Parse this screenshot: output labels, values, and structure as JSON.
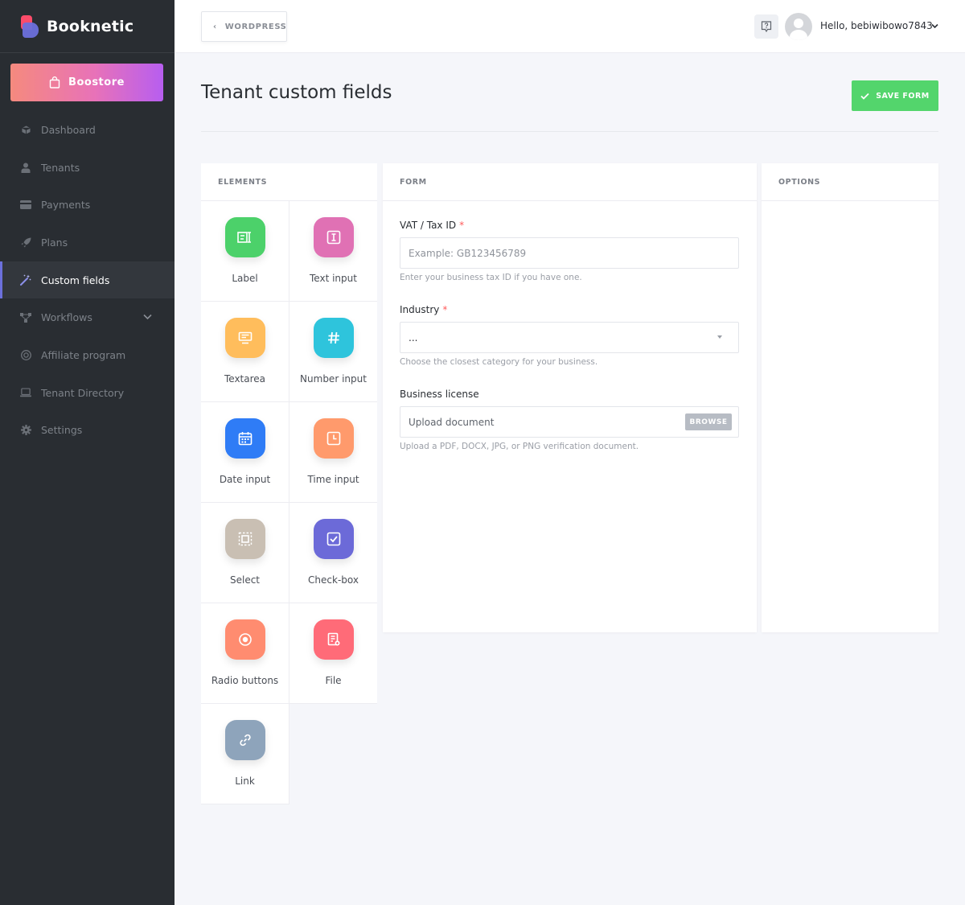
{
  "brand": {
    "name": "Booknetic"
  },
  "sidebar": {
    "boostore_label": "Boostore",
    "items": [
      {
        "label": "Dashboard",
        "icon": "cube-icon"
      },
      {
        "label": "Tenants",
        "icon": "user-tie-icon"
      },
      {
        "label": "Payments",
        "icon": "credit-card-icon"
      },
      {
        "label": "Plans",
        "icon": "rocket-icon"
      },
      {
        "label": "Custom fields",
        "icon": "magic-wand-icon",
        "active": true
      },
      {
        "label": "Workflows",
        "icon": "workflow-icon",
        "has_submenu": true
      },
      {
        "label": "Affiliate program",
        "icon": "target-icon"
      },
      {
        "label": "Tenant Directory",
        "icon": "laptop-icon"
      },
      {
        "label": "Settings",
        "icon": "gear-icon"
      }
    ]
  },
  "topbar": {
    "back_label": "WORDPRESS",
    "greeting": "Hello, bebiwibowo7843"
  },
  "page": {
    "title": "Tenant custom fields",
    "save_label": "SAVE FORM"
  },
  "panels": {
    "elements_title": "ELEMENTS",
    "form_title": "FORM",
    "options_title": "OPTIONS"
  },
  "elements": [
    {
      "label": "Label",
      "icon": "label-icon",
      "color": "#4cd16a"
    },
    {
      "label": "Text input",
      "icon": "text-cursor-icon",
      "color": "#e071b4"
    },
    {
      "label": "Textarea",
      "icon": "textarea-icon",
      "color": "#ffbd5c"
    },
    {
      "label": "Number input",
      "icon": "hash-icon",
      "color": "#2ec4dc"
    },
    {
      "label": "Date input",
      "icon": "calendar-icon",
      "color": "#2f7cf6"
    },
    {
      "label": "Time input",
      "icon": "clock-icon",
      "color": "#ff9a6c"
    },
    {
      "label": "Select",
      "icon": "select-icon",
      "color": "#c9bfb3"
    },
    {
      "label": "Check-box",
      "icon": "checkbox-icon",
      "color": "#6c6ad8"
    },
    {
      "label": "Radio buttons",
      "icon": "radio-icon",
      "color": "#ff8c70"
    },
    {
      "label": "File",
      "icon": "file-icon",
      "color": "#ff6b78"
    },
    {
      "label": "Link",
      "icon": "link-icon",
      "color": "#8ea4bb"
    }
  ],
  "form": {
    "vat": {
      "label": "VAT / Tax ID",
      "required_mark": "*",
      "placeholder": "Example: GB123456789",
      "help": "Enter your business tax ID if you have one."
    },
    "industry": {
      "label": "Industry",
      "required_mark": "*",
      "value": "...",
      "help": "Choose the closest category for your business."
    },
    "license": {
      "label": "Business license",
      "placeholder": "Upload document",
      "browse_label": "BROWSE",
      "help": "Upload a PDF, DOCX, JPG, or PNG verification document."
    }
  },
  "colors": {
    "sidebar_bg": "#292d32",
    "accent": "#6c70dc",
    "save_green": "#53d56c"
  }
}
